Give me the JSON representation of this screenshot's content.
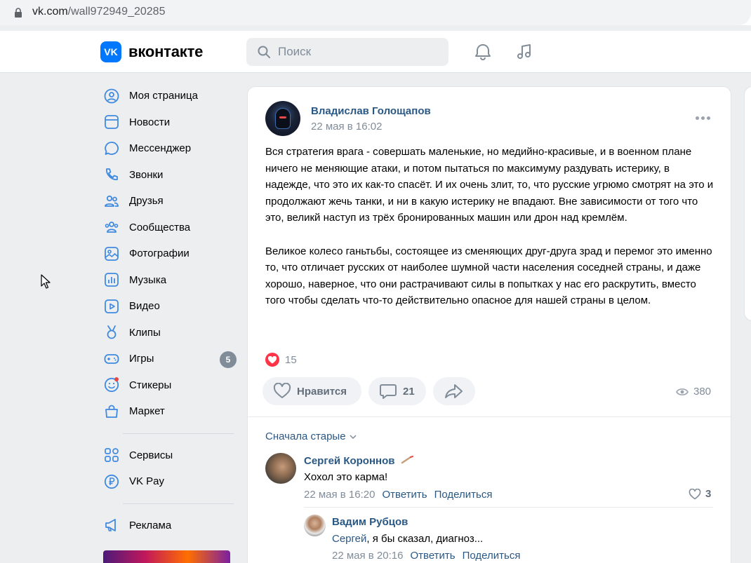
{
  "browser": {
    "url_host": "vk.com",
    "url_path": "/wall972949_20285"
  },
  "header": {
    "logo_mark": "VK",
    "logo_text": "вконтакте",
    "search_placeholder": "Поиск",
    "icons": [
      "bell-icon",
      "music-icon"
    ]
  },
  "sidebar": {
    "items": [
      {
        "label": "Моя страница",
        "icon": "user-circle-icon"
      },
      {
        "label": "Новости",
        "icon": "news-icon"
      },
      {
        "label": "Мессенджер",
        "icon": "message-icon"
      },
      {
        "label": "Звонки",
        "icon": "phone-icon"
      },
      {
        "label": "Друзья",
        "icon": "friends-icon"
      },
      {
        "label": "Сообщества",
        "icon": "communities-icon"
      },
      {
        "label": "Фотографии",
        "icon": "photo-icon"
      },
      {
        "label": "Музыка",
        "icon": "music-icon"
      },
      {
        "label": "Видео",
        "icon": "video-icon"
      },
      {
        "label": "Клипы",
        "icon": "clips-icon"
      },
      {
        "label": "Игры",
        "icon": "gamepad-icon",
        "badge": "5"
      },
      {
        "label": "Стикеры",
        "icon": "sticker-icon"
      },
      {
        "label": "Маркет",
        "icon": "bag-icon"
      }
    ],
    "secondary": [
      {
        "label": "Сервисы",
        "icon": "grid-icon"
      },
      {
        "label": "VK Pay",
        "icon": "ruble-icon"
      }
    ],
    "ads": {
      "label": "Реклама",
      "icon": "megaphone-icon"
    }
  },
  "post": {
    "author": "Владислав Голощапов",
    "date": "22 мая в 16:02",
    "paragraphs": [
      "Вся стратегия врага - совершать маленькие, но медийно-красивые, и в военном плане ничего не меняющие атаки, и потом пытаться по максимуму раздувать истерику, в надежде, что это их как-то спасёт. И их очень злит, то, что русские угрюмо смотрят на это и продолжают жечь танки, и ни в какую истерику не впадают. Вне зависимости от того что это, великй наступ из трёх бронированных машин или дрон над кремлём.",
      "Великое колесо ганьтьбы, состоящее из сменяющих друг-друга зрад и перемог это именно то, что отличает русских от наиболее шумной части населения соседней страны, и даже хорошо, наверное, что они растрачивают силы в попытках у нас его раскрутить, вместо того чтобы сделать что-то действительно опасное для нашей страны в целом."
    ],
    "reaction_count": "15",
    "like_label": "Нравится",
    "comments_count": "21",
    "views": "380",
    "sort_label": "Сначала старые"
  },
  "comments": [
    {
      "author": "Сергей Короннов",
      "text": "Хохол это карма!",
      "date": "22 мая в 16:20",
      "reply": "Ответить",
      "share": "Поделиться",
      "likes": "3"
    },
    {
      "author": "Вадим Рубцов",
      "mention": "Сергей",
      "text": ", я бы сказал, диагноз...",
      "date": "22 мая в 20:16",
      "reply": "Ответить",
      "share": "Поделиться"
    }
  ],
  "colors": {
    "accent": "#0077ff",
    "link": "#2a5885",
    "muted": "#818c99",
    "like_red": "#ff3347"
  }
}
